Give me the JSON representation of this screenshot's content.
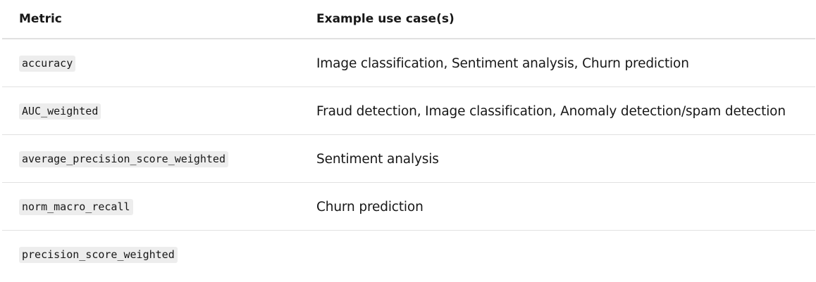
{
  "table": {
    "headers": {
      "metric": "Metric",
      "use_cases": "Example use case(s)"
    },
    "rows": [
      {
        "metric": "accuracy",
        "use_cases": "Image classification, Sentiment analysis, Churn prediction"
      },
      {
        "metric": "AUC_weighted",
        "use_cases": "Fraud detection, Image classification, Anomaly detection/spam detection"
      },
      {
        "metric": "average_precision_score_weighted",
        "use_cases": "Sentiment analysis"
      },
      {
        "metric": "norm_macro_recall",
        "use_cases": "Churn prediction"
      },
      {
        "metric": "precision_score_weighted",
        "use_cases": ""
      }
    ]
  }
}
